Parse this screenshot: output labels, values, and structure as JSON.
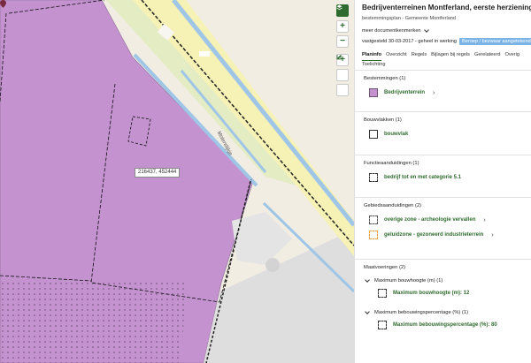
{
  "map": {
    "coordinate": "216437, 452444",
    "road_name": "Molendijkje",
    "controls": [
      {
        "name": "layers-icon",
        "glyph": ""
      },
      {
        "name": "zoom-in-button",
        "glyph": "+"
      },
      {
        "name": "zoom-out-button",
        "glyph": "−"
      },
      {
        "name": "add-button",
        "glyph": "+"
      },
      {
        "name": "measure-icon",
        "glyph": ""
      },
      {
        "name": "draw-icon",
        "glyph": ""
      }
    ]
  },
  "panel": {
    "title": "Bedrijventerreinen Montferland, eerste herziening",
    "subtitle": "bestemmingsplan - Gemeente Montferland",
    "meta_label": "meer documentkenmerken",
    "status": "vastgesteld 30-03-2017 - geheel in werking",
    "badge": "Beroep / bezwaar aangetekend",
    "tabs": [
      "Planinfo",
      "Overzicht",
      "Regels",
      "Bijlagen bij regels",
      "Gerelateerd",
      "Overig",
      "Toelichting"
    ],
    "sections": [
      {
        "title": "Bestemmingen (1)",
        "items": [
          {
            "label": "Bedrijventerrein",
            "arrow": "›",
            "swatch": "bedrijf"
          }
        ]
      },
      {
        "title": "Bouwvlakken (1)",
        "items": [
          {
            "label": "bouwvlak",
            "arrow": "",
            "swatch": "bouwvlak"
          }
        ]
      },
      {
        "title": "Functieaanduidingen (1)",
        "items": [
          {
            "label": "bedrijf tot en met categorie 5.1",
            "arrow": "",
            "swatch": "functie"
          }
        ]
      },
      {
        "title": "Gebiedsaanduidingen (2)",
        "items": [
          {
            "label": "overige zone - archeologie vervallen",
            "arrow": "›",
            "swatch": "archeo"
          },
          {
            "label": "geluidzone - gezoneerd industrieterrein",
            "arrow": "›",
            "swatch": "geluid"
          }
        ]
      },
      {
        "title": "Maatvoeringen (2)",
        "groups": [
          {
            "title": "Maximum bouwhoogte (m) (1)",
            "item": "Maximum bouwhoogte (m): 12"
          },
          {
            "title": "Maximum bebouwingspercentage (%) (1)",
            "item": "Maximum bebouwingspercentage (%): 80"
          }
        ]
      }
    ]
  },
  "colors": {
    "accent": "#2f6b2f",
    "bestemming": "#c392cf",
    "badge": "#7ab3e6"
  }
}
